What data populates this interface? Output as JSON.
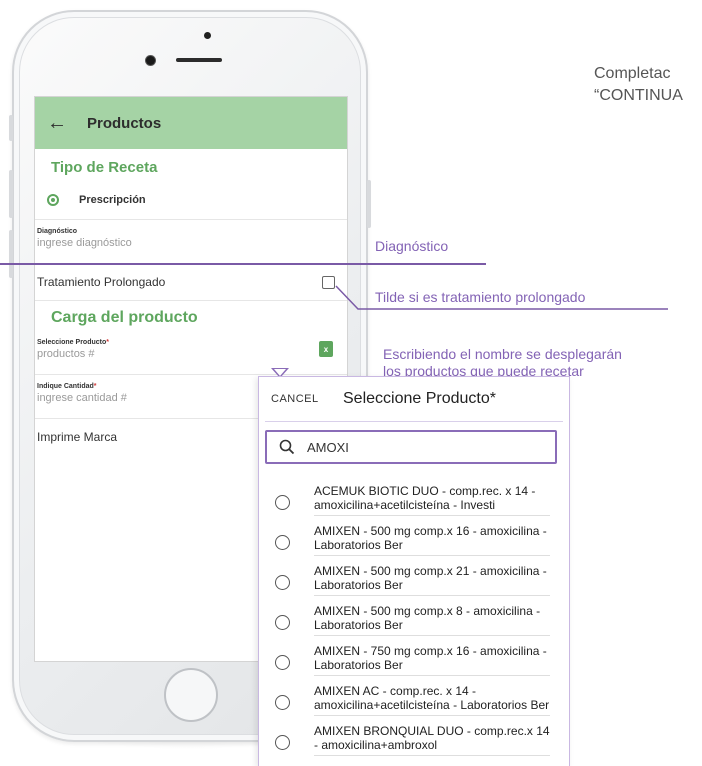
{
  "annotation_top": "Completac\n“CONTINUA",
  "annotations": {
    "diagnostico": "Diagnóstico",
    "tilde": "Tilde si es tratamiento prolongado",
    "escribiendo_line1": "Escribiendo el nombre se desplegarán",
    "escribiendo_line2": "los productos que puede recetar"
  },
  "app": {
    "title": "Productos",
    "back_icon": "←",
    "section_tipo": "Tipo de Receta",
    "radio_label": "Prescripción",
    "diag_label": "Diagnóstico",
    "diag_placeholder": "ingrese diagnóstico",
    "tratamiento_label": "Tratamiento Prolongado",
    "section_carga": "Carga del producto",
    "producto_label": "Seleccione Producto",
    "producto_placeholder": "productos #",
    "cantidad_label": "Indique Cantidad",
    "cantidad_placeholder": "ingrese cantidad #",
    "imprime_label": "Imprime Marca",
    "green_btn": "x",
    "required_mark": "*"
  },
  "dialog": {
    "cancel": "CANCEL",
    "title": "Seleccione Producto*",
    "search_value": "AMOXI",
    "options": [
      "ACEMUK BIOTIC DUO - comp.rec. x 14 - amoxicilina+acetilcisteína - Investi",
      "AMIXEN - 500 mg comp.x 16 - amoxicilina - Laboratorios Ber",
      "AMIXEN - 500 mg comp.x 21 - amoxicilina - Laboratorios Ber",
      "AMIXEN - 500 mg comp.x 8 - amoxicilina - Laboratorios Ber",
      "AMIXEN - 750 mg comp.x 16 - amoxicilina - Laboratorios Ber",
      "AMIXEN AC - comp.rec. x 14 - amoxicilina+acetilcisteína - Laboratorios Ber",
      "AMIXEN BRONQUIAL DUO - comp.rec.x 14 - amoxicilina+ambroxol"
    ]
  },
  "colors": {
    "appbar": "#a5d3a5",
    "accent_green": "#5ea65e",
    "annotation_purple": "#8363b5"
  }
}
